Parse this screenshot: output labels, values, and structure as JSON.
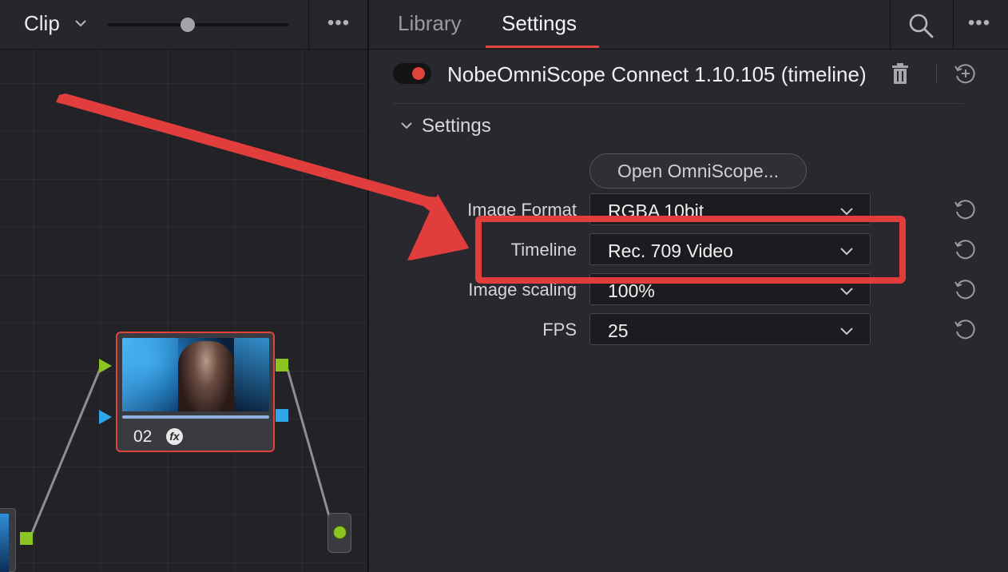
{
  "node_editor": {
    "mode_label": "Clip",
    "node": {
      "number": "02",
      "fx_badge": "fx"
    },
    "icons": [
      "chevron-down-icon",
      "more-icon",
      "fx-icon"
    ]
  },
  "inspector": {
    "tabs": [
      {
        "label": "Library",
        "active": false
      },
      {
        "label": "Settings",
        "active": true
      }
    ],
    "effect": {
      "title": "NobeOmniScope Connect 1.10.105 (timeline)",
      "enabled": true
    },
    "section_title": "Settings",
    "open_button": "Open OmniScope...",
    "params": [
      {
        "label": "Image Format",
        "value": "RGBA 10bit"
      },
      {
        "label": "Timeline",
        "value": "Rec. 709 Video"
      },
      {
        "label": "Image scaling",
        "value": "100%"
      },
      {
        "label": "FPS",
        "value": "25"
      }
    ]
  },
  "colors": {
    "accent_red": "#e0453b",
    "port_green": "#8cc421",
    "port_blue": "#2ea6e8",
    "annotation_red": "#e23d3d"
  }
}
